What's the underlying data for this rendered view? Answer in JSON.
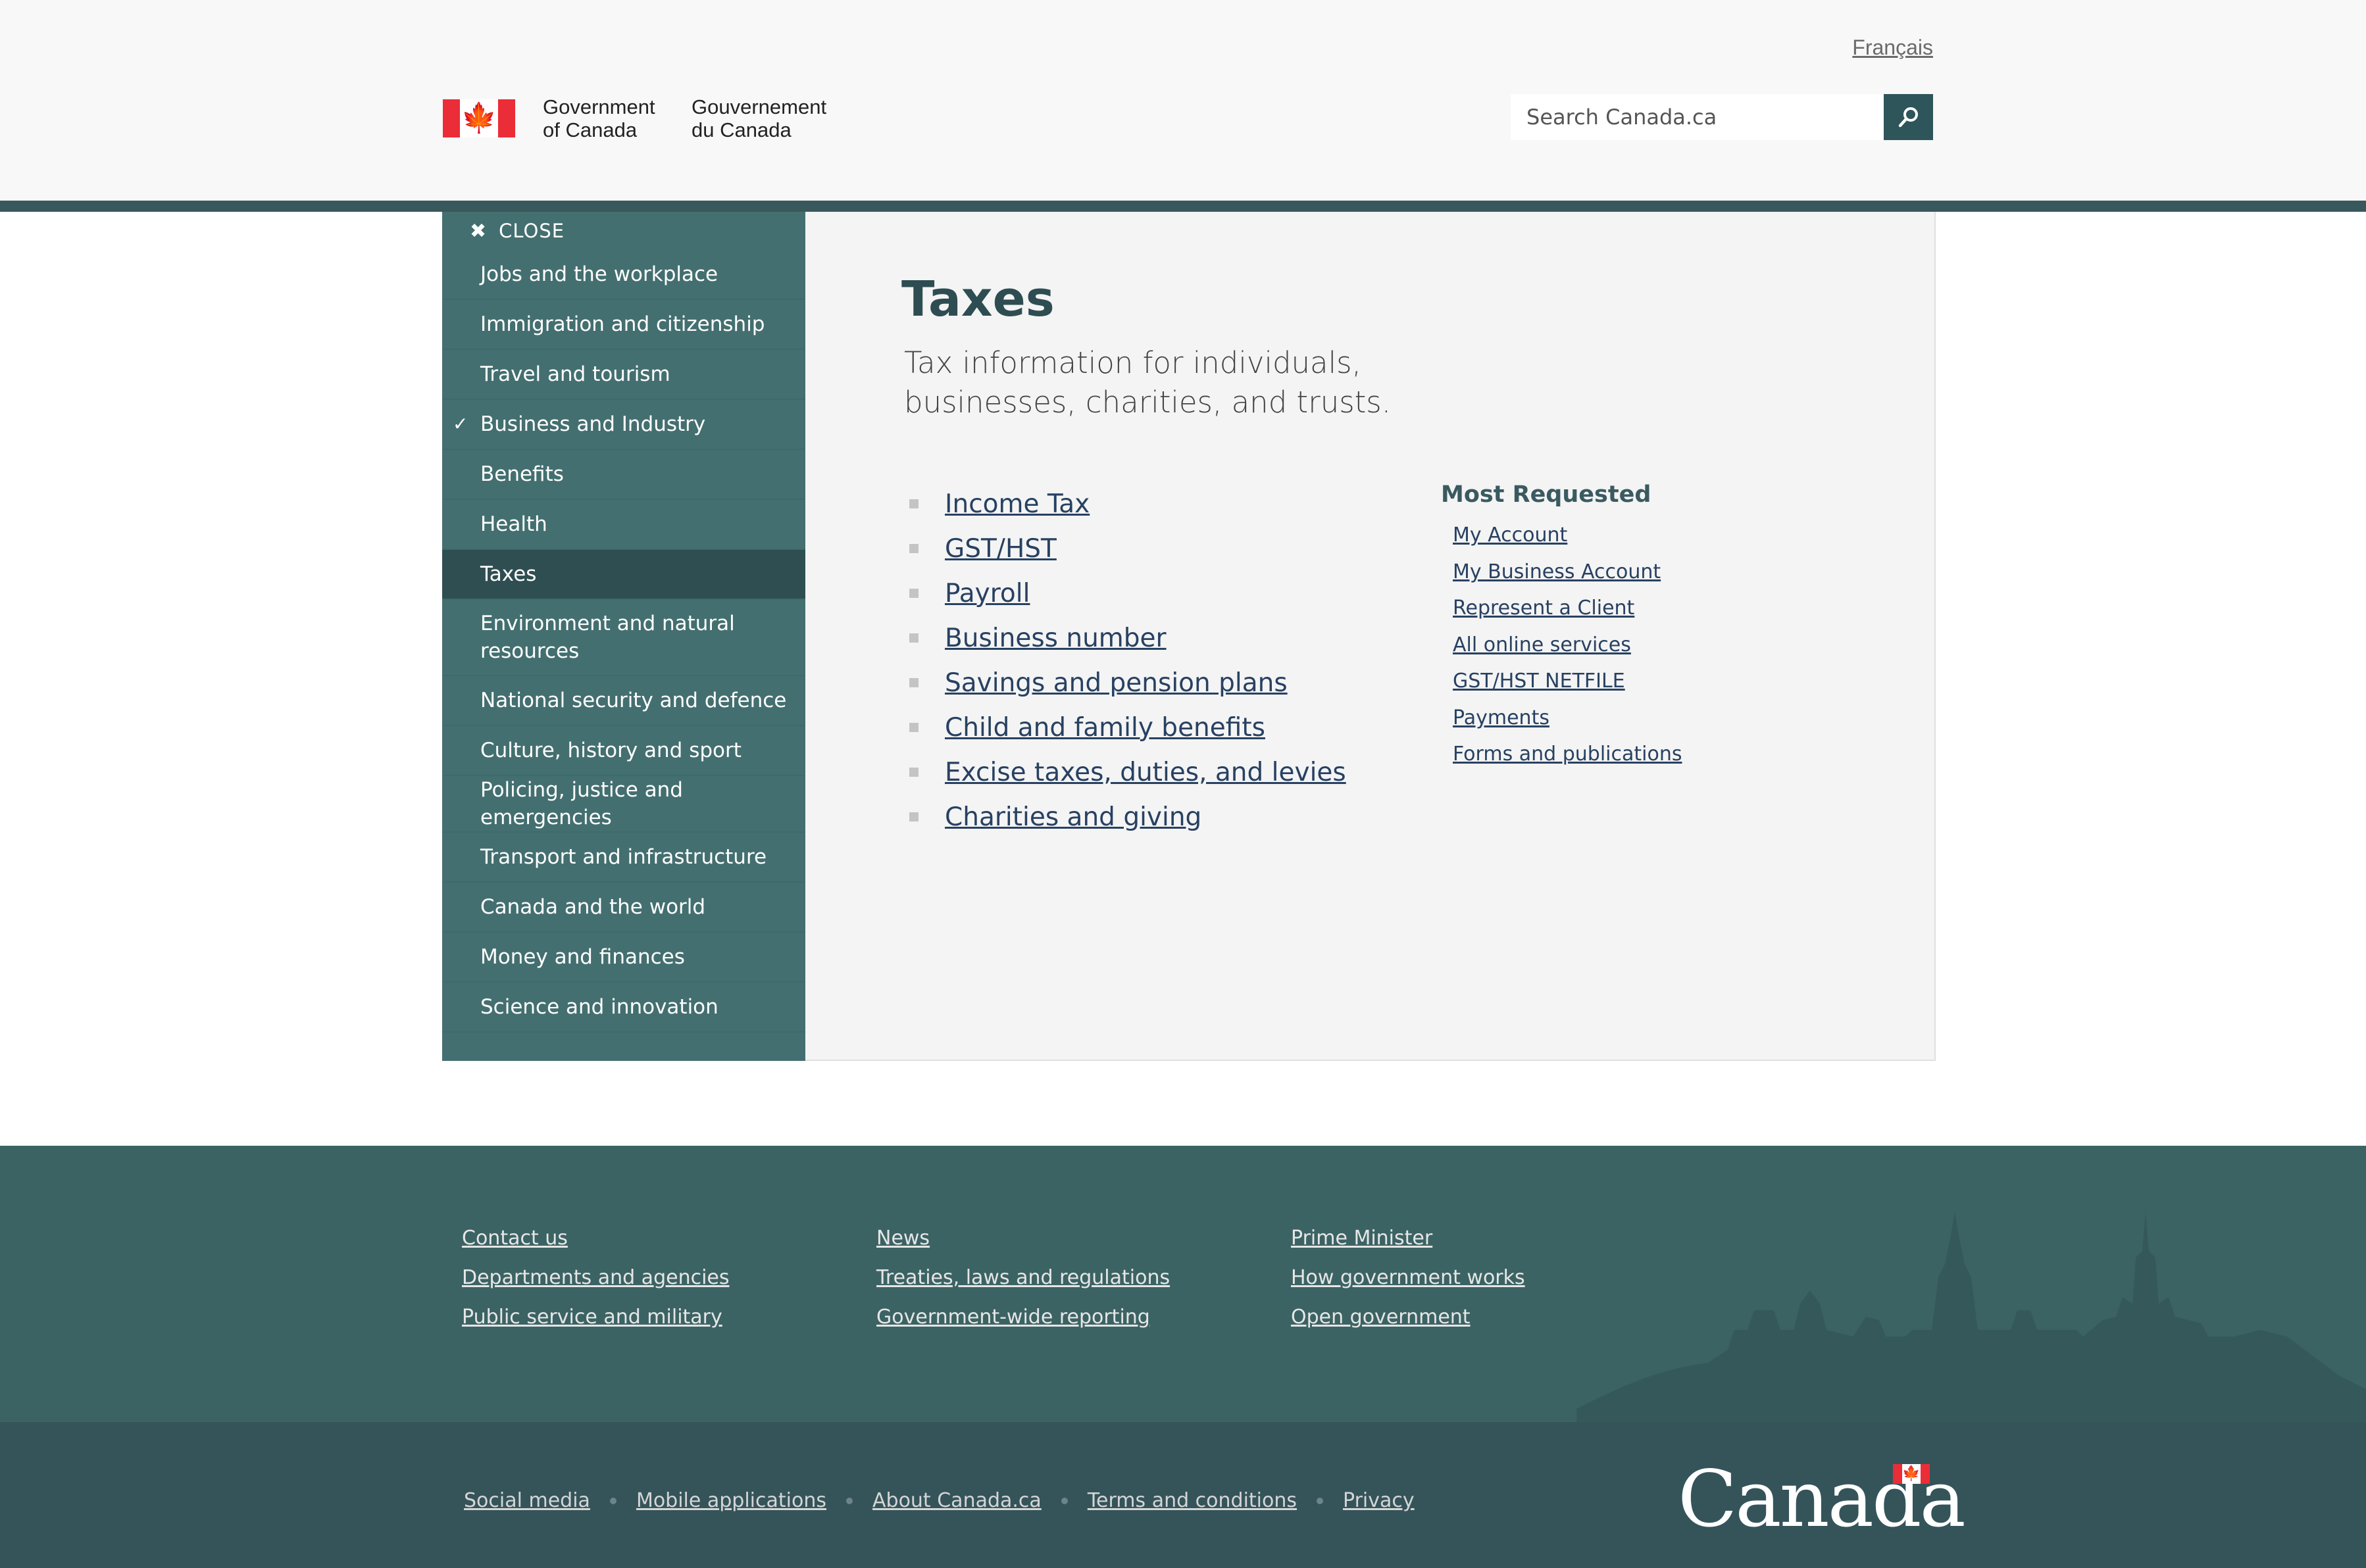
{
  "header": {
    "language_link": "Français",
    "brand_en": [
      "Government",
      "of Canada"
    ],
    "brand_fr": [
      "Gouvernement",
      "du Canada"
    ],
    "search_placeholder": "Search Canada.ca"
  },
  "menu": {
    "close_label": "CLOSE",
    "items": [
      {
        "label": "Jobs and the workplace"
      },
      {
        "label": "Immigration and citizenship"
      },
      {
        "label": "Travel and tourism"
      },
      {
        "label": "Business and Industry"
      },
      {
        "label": "Benefits"
      },
      {
        "label": "Health"
      },
      {
        "label": "Taxes"
      },
      {
        "label": "Environment and natural resources"
      },
      {
        "label": "National security and defence"
      },
      {
        "label": "Culture, history and sport"
      },
      {
        "label": "Policing, justice and emergencies"
      },
      {
        "label": "Transport and infrastructure"
      },
      {
        "label": "Canada and the world"
      },
      {
        "label": "Money and finances"
      },
      {
        "label": "Science and innovation"
      }
    ]
  },
  "content": {
    "title": "Taxes",
    "subtitle": "Tax information for individuals, businesses, charities, and trusts.",
    "links": [
      "Income Tax",
      "GST/HST",
      "Payroll",
      "Business number",
      "Savings and pension plans",
      "Child and family benefits",
      "Excise taxes, duties, and levies",
      "Charities and giving"
    ],
    "most_requested_heading": "Most Requested",
    "most_requested": [
      "My Account",
      "My Business Account",
      "Represent a Client",
      "All online services",
      "GST/HST NETFILE",
      "Payments",
      "Forms and publications"
    ]
  },
  "footer": {
    "columns": [
      [
        "Contact us",
        "Departments and agencies",
        "Public service and military"
      ],
      [
        "News",
        "Treaties, laws and regulations",
        "Government-wide reporting"
      ],
      [
        "Prime Minister",
        "How government works",
        "Open government"
      ]
    ],
    "legal": [
      "Social media",
      "Mobile applications",
      "About Canada.ca",
      "Terms and conditions",
      "Privacy"
    ],
    "wordmark": "Canada"
  },
  "colors": {
    "header_bg": "#f8f8f8",
    "menu_bg": "#446f70",
    "menu_active": "#2f4e51",
    "title": "#2e4d52",
    "link": "#284162",
    "footer_top": "#3c6364",
    "footer_bottom": "#34545a",
    "flag_red": "#eb2d37"
  },
  "icons": {
    "flag": "canada-flag-icon",
    "search": "magnifier-icon",
    "close": "close-icon",
    "check": "checkmark-icon"
  }
}
